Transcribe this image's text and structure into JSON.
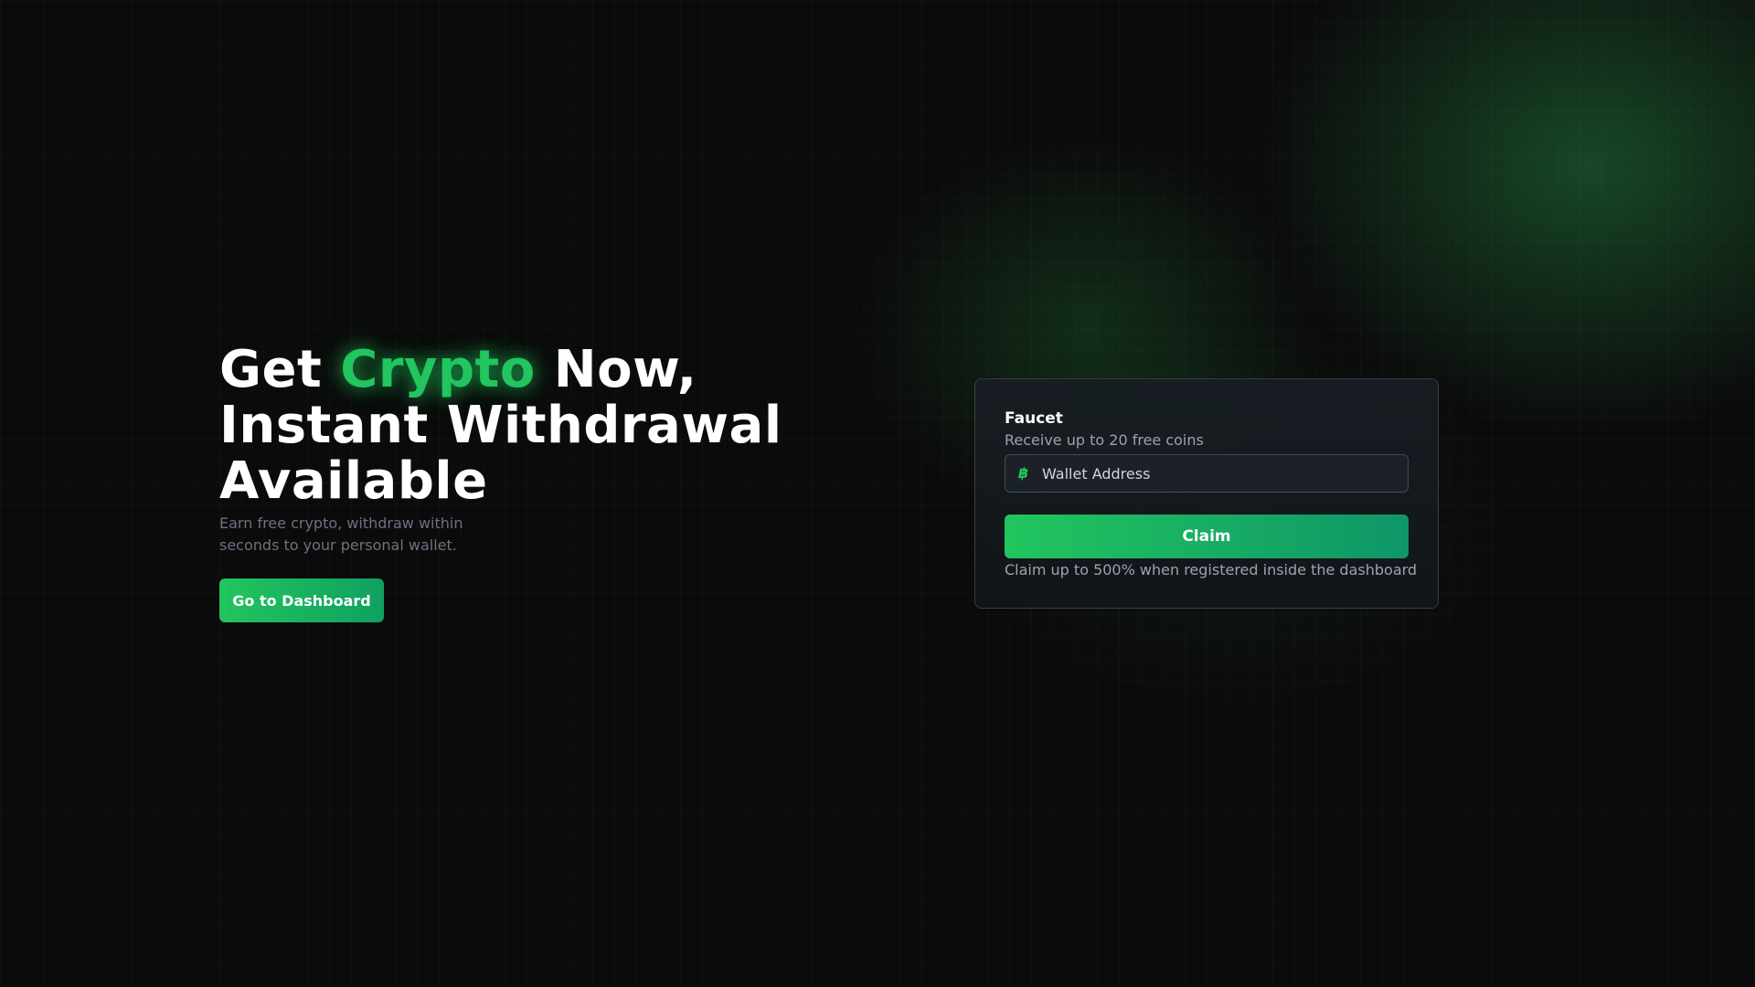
{
  "hero": {
    "title_part1": "Get ",
    "title_accent": "Crypto",
    "title_part2": " Now,",
    "title_line2": "Instant Withdrawal",
    "title_line3": "Available",
    "subtitle": "Earn free crypto, withdraw within seconds to your personal wallet.",
    "dashboard_button": "Go to Dashboard"
  },
  "faucet": {
    "title": "Faucet",
    "subtitle": "Receive up to 20 free coins",
    "wallet_icon": "bitcoin-icon",
    "wallet_glyph": "฿",
    "wallet_placeholder": "Wallet Address",
    "claim_button": "Claim",
    "note": "Claim up to 500% when registered inside the dashboard"
  },
  "colors": {
    "accent": "#22c55e",
    "background": "#0b0b0b",
    "muted_text": "#9ca3af"
  }
}
